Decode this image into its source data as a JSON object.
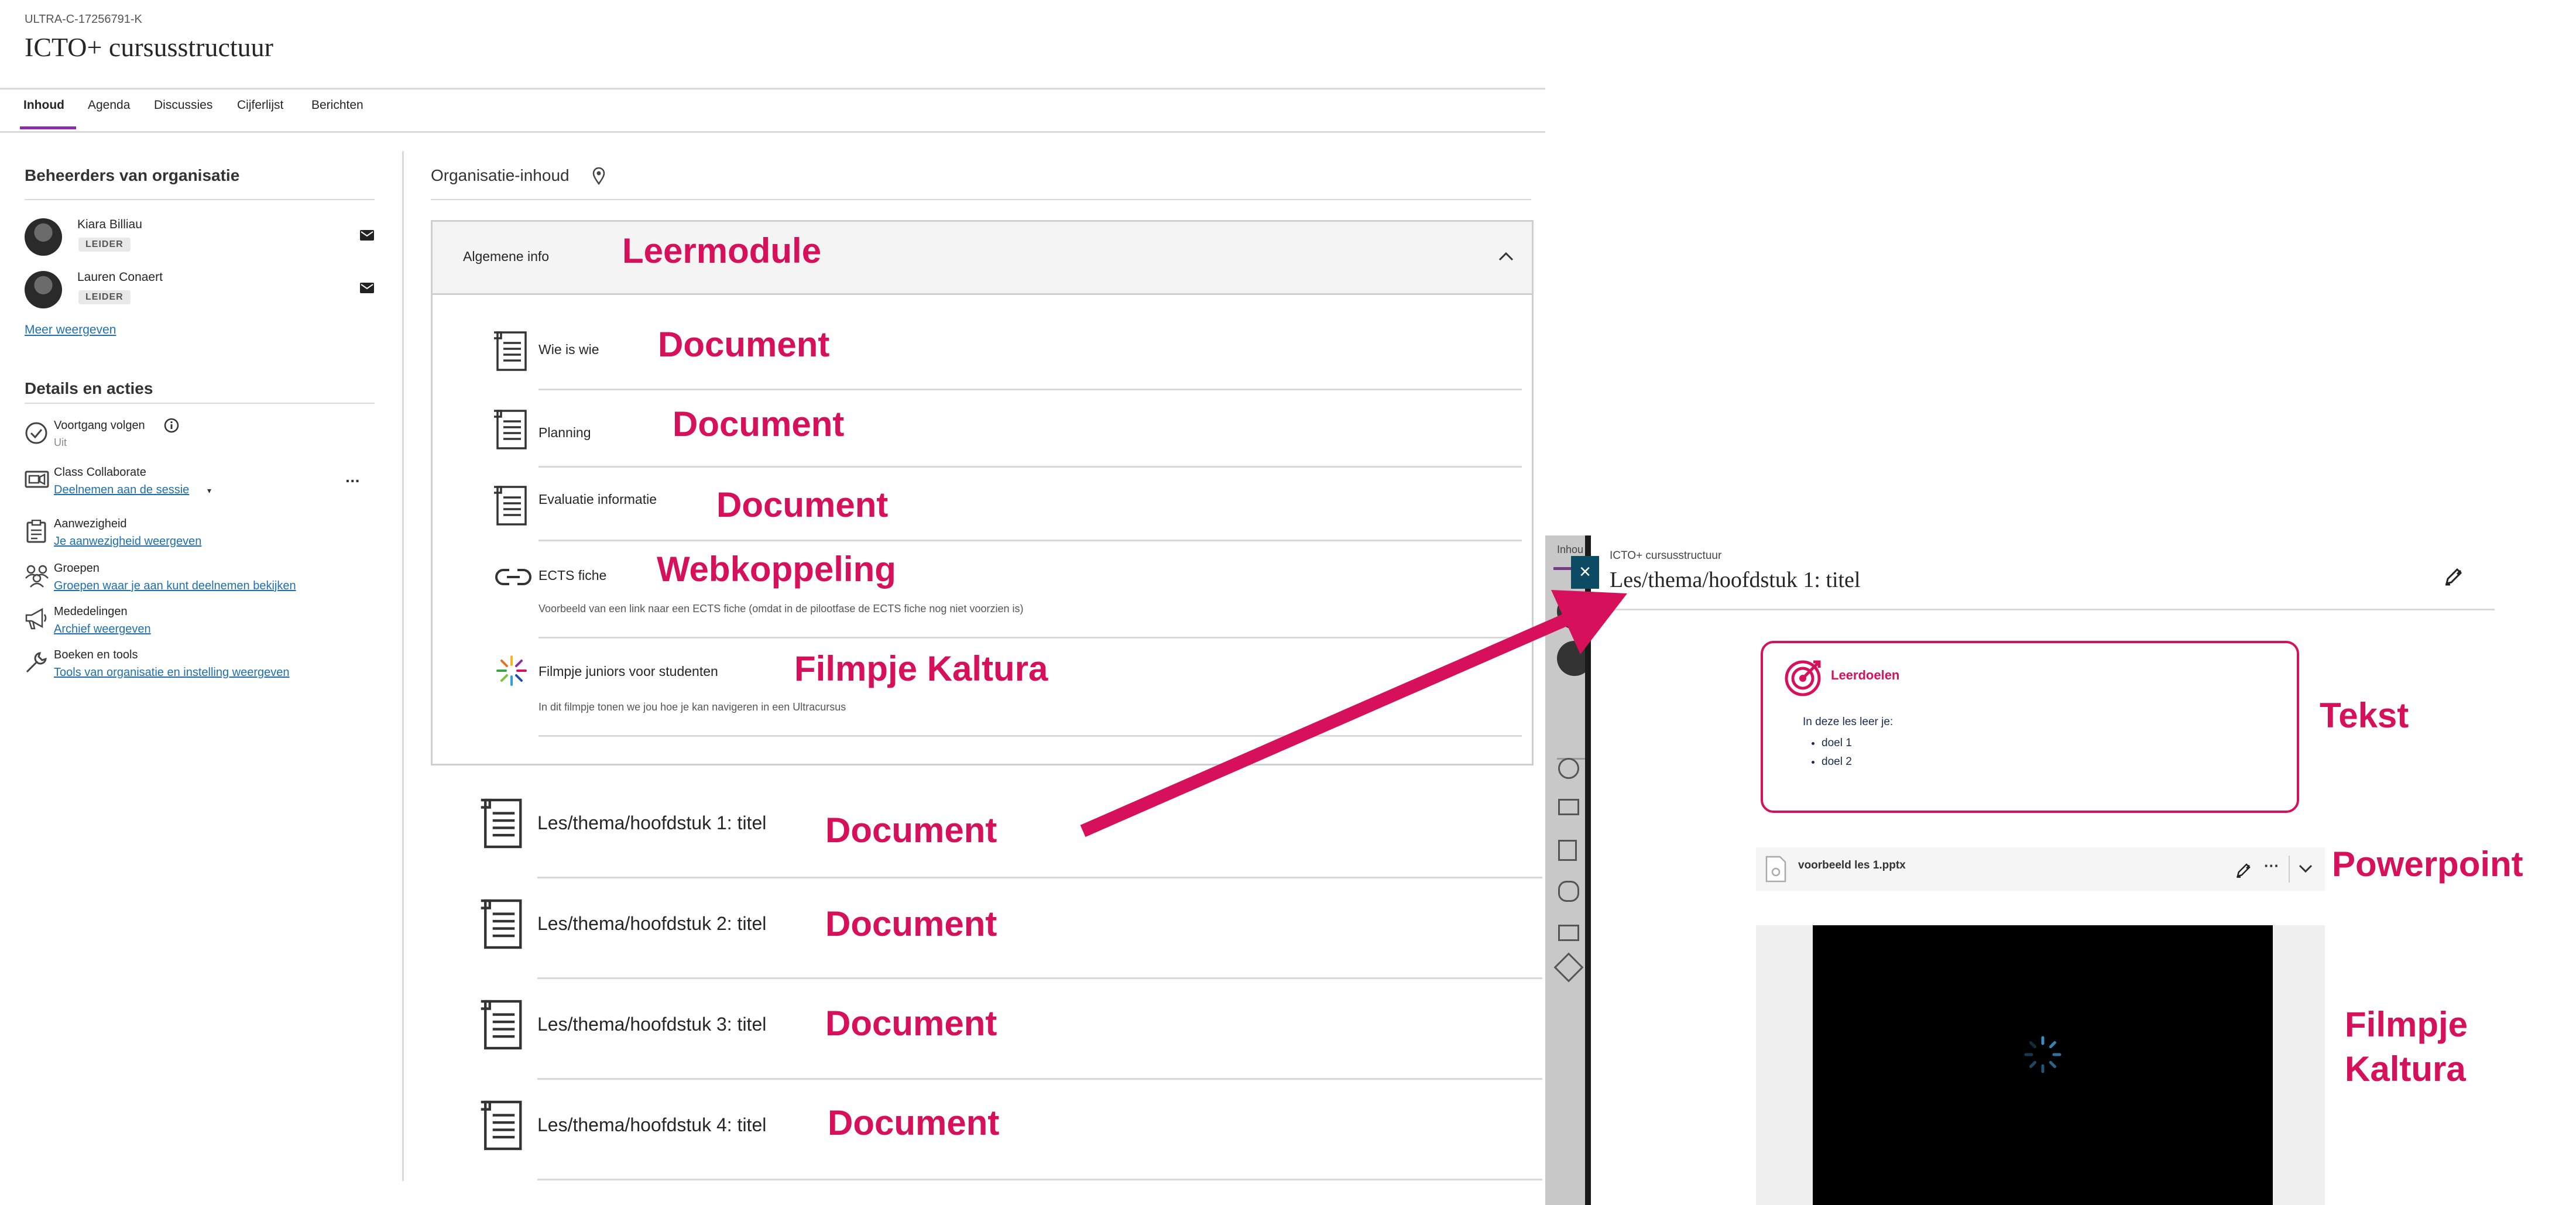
{
  "course": {
    "id": "ULTRA-C-17256791-K",
    "title": "ICTO+ cursusstructuur"
  },
  "tabs": [
    {
      "label": "Inhoud"
    },
    {
      "label": "Agenda"
    },
    {
      "label": "Discussies"
    },
    {
      "label": "Cijferlijst"
    },
    {
      "label": "Berichten"
    }
  ],
  "sidebar": {
    "admins_heading": "Beheerders van organisatie",
    "admins": [
      {
        "name": "Kiara Billiau",
        "role": "LEIDER"
      },
      {
        "name": "Lauren Conaert",
        "role": "LEIDER"
      }
    ],
    "more_link": "Meer weergeven",
    "details_heading": "Details en acties",
    "details": [
      {
        "title": "Voortgang volgen",
        "sub": "Uit",
        "icon": "check-circle-icon"
      },
      {
        "title": "Class Collaborate",
        "sub": "Deelnemen aan de sessie",
        "icon": "video-icon"
      },
      {
        "title": "Aanwezigheid",
        "sub": "Je aanwezigheid weergeven",
        "icon": "clipboard-icon"
      },
      {
        "title": "Groepen",
        "sub": "Groepen waar je aan kunt deelnemen bekijken",
        "icon": "groups-icon"
      },
      {
        "title": "Mededelingen",
        "sub": "Archief weergeven",
        "icon": "megaphone-icon"
      },
      {
        "title": "Boeken en tools",
        "sub": "Tools van organisatie en instelling weergeven",
        "icon": "wrench-icon"
      }
    ],
    "more_icon": "ellipsis-icon"
  },
  "content": {
    "heading": "Organisatie-inhoud",
    "module": {
      "title": "Algemene info",
      "annotation": "Leermodule",
      "items": [
        {
          "title": "Wie is wie",
          "annotation": "Document",
          "description": "",
          "icon": "document-icon"
        },
        {
          "title": "Planning",
          "annotation": "Document",
          "description": "",
          "icon": "document-icon"
        },
        {
          "title": "Evaluatie informatie",
          "annotation": "Document",
          "description": "",
          "icon": "document-icon"
        },
        {
          "title": "ECTS fiche",
          "annotation": "Webkoppeling",
          "description": "Voorbeeld van een link naar een ECTS fiche (omdat in de pilootfase de ECTS fiche nog niet voorzien is)",
          "icon": "link-icon"
        },
        {
          "title": "Filmpje juniors voor studenten",
          "annotation": "Filmpje Kaltura",
          "description": "In dit filmpje tonen we jou hoe je kan navigeren in een Ultracursus",
          "icon": "kaltura-icon"
        }
      ]
    },
    "lessons": [
      {
        "title": "Les/thema/hoofdstuk 1: titel",
        "annotation": "Document"
      },
      {
        "title": "Les/thema/hoofdstuk 2: titel",
        "annotation": "Document"
      },
      {
        "title": "Les/thema/hoofdstuk 3: titel",
        "annotation": "Document"
      },
      {
        "title": "Les/thema/hoofdstuk 4: titel",
        "annotation": "Document"
      }
    ]
  },
  "panel": {
    "left_tab": "Inhou",
    "breadcrumb": "ICTO+ cursusstructuur",
    "title": "Les/thema/hoofdstuk 1: titel",
    "close_label": "×",
    "text_block": {
      "heading": "Leerdoelen",
      "intro": "In deze les leer je:",
      "bullets": [
        "doel 1",
        "doel 2"
      ],
      "annotation": "Tekst"
    },
    "file": {
      "name": "voorbeeld les 1.pptx",
      "annotation": "Powerpoint",
      "more": "···"
    },
    "video": {
      "annotation_line1": "Filmpje",
      "annotation_line2": "Kaltura"
    }
  },
  "colors": {
    "annotation_red": "#d6105a",
    "tab_underline": "#8a2ea3",
    "link_blue": "#1e6fb0",
    "arrow": "#d6105a"
  }
}
